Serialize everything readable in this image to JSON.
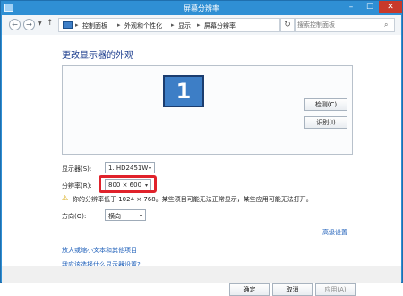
{
  "window": {
    "title": "屏幕分辨率",
    "min": "–",
    "max": "☐",
    "close": "✕"
  },
  "addressbar": {
    "back": "←",
    "forward": "→",
    "dropdown": "▼",
    "up": "↑",
    "separator": "▸",
    "breadcrumb": [
      "控制面板",
      "外观和个性化",
      "显示",
      "屏幕分辨率"
    ],
    "refresh": "↻",
    "search_placeholder": "搜索控制面板",
    "search_icon": "⌕"
  },
  "main": {
    "heading": "更改显示器的外观",
    "monitor_number": "1",
    "detect_button": "检测(C)",
    "identify_button": "识别(I)",
    "display_label": "显示器(S):",
    "display_value": "1. HD2451W",
    "resolution_label": "分辨率(R):",
    "resolution_value": "800 × 600",
    "warning": "你的分辨率低于 1024 × 768。某些项目可能无法正常显示，某些应用可能无法打开。",
    "orientation_label": "方向(O):",
    "orientation_value": "横向",
    "dropdown_arrow": "▾",
    "warning_icon": "⚠",
    "advanced_link": "高级设置",
    "enlarge_link": "放大或缩小文本和其他项目",
    "which_link": "我应该选择什么显示器设置?",
    "ok_button": "确定",
    "cancel_button": "取消",
    "apply_button": "应用(A)"
  },
  "colors": {
    "titlebar": "#2f8fd4",
    "heading": "#1e3f8f",
    "link": "#1a5cb8",
    "highlight": "#e0222b"
  }
}
